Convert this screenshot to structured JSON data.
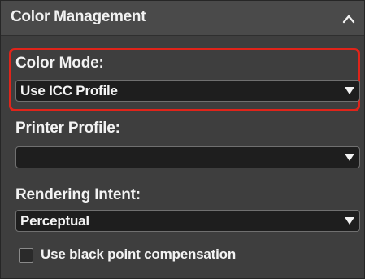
{
  "panel": {
    "title": "Color Management",
    "collapse_icon": "chevron-up-icon"
  },
  "color_mode": {
    "label": "Color Mode:",
    "value": "Use ICC Profile",
    "arrow_icon": "triangle-down-icon",
    "highlight_color": "#e0241a"
  },
  "printer_profile": {
    "label": "Printer Profile:",
    "value": "",
    "arrow_icon": "triangle-down-icon"
  },
  "rendering_intent": {
    "label": "Rendering Intent:",
    "value": "Perceptual",
    "arrow_icon": "triangle-down-icon"
  },
  "black_point": {
    "label": "Use black point compensation",
    "checked": false
  },
  "colors": {
    "panel_bg": "#3e3e3e",
    "header_bg": "#4a4a4a",
    "select_bg": "#1e1e1e",
    "text": "#f3f3f3"
  }
}
